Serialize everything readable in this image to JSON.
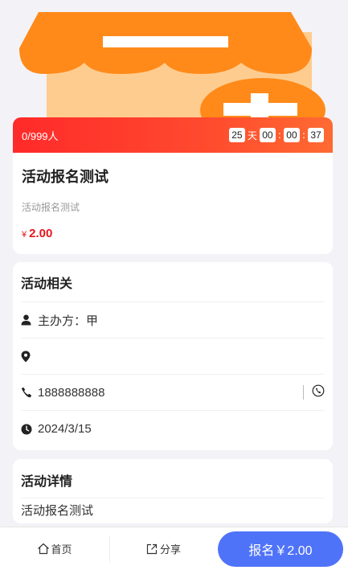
{
  "event": {
    "participants": "0/999人",
    "countdown": {
      "days": "25",
      "days_unit": "天",
      "hours": "00",
      "minutes": "00",
      "seconds": "37",
      "sep": ":"
    },
    "title": "活动报名测试",
    "subtitle": "活动报名测试",
    "price_symbol": "¥",
    "price": "2.00"
  },
  "related": {
    "heading": "活动相关",
    "organizer": "主办方：甲",
    "location": "",
    "phone": "1888888888",
    "date": "2024/3/15"
  },
  "details": {
    "heading": "活动详情",
    "body": "活动报名测试"
  },
  "bottom": {
    "home_label": "首页",
    "share_label": "分享",
    "signup_label": "报名￥2.00"
  },
  "colors": {
    "accent_red": "#ff2a2a",
    "price_red": "#e8151c",
    "signup_blue": "#4f73f8",
    "hero_orange": "#ff8a1a",
    "hero_light": "#ffcc8f"
  }
}
